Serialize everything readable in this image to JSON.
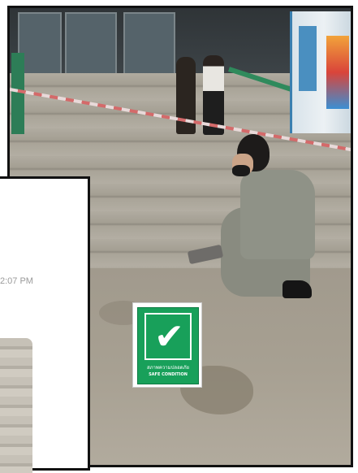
{
  "photo": {
    "scene": "outdoor-stairs-inspection"
  },
  "sign": {
    "icon": "check-icon",
    "thai_text": "สภาพความปลอดภัย",
    "english_text": "SAFE CONDITION",
    "color": "#18a05a"
  },
  "chat_panel": {
    "timestamp": "2:07 PM"
  }
}
